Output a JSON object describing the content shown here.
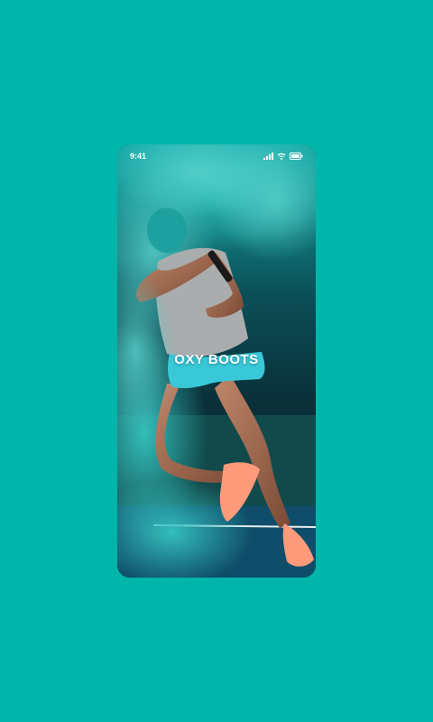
{
  "status_bar": {
    "time": "9:41",
    "icons": [
      "signal-icon",
      "wifi-icon",
      "battery-icon"
    ]
  },
  "splash": {
    "brand_title": "OXY BOOTS"
  },
  "colors": {
    "background": "#00b5aa",
    "smoke": "#1fb3b0",
    "shorts": "#39c8d8",
    "shoes": "#ff9a7a",
    "court": "#0f4d6a"
  }
}
